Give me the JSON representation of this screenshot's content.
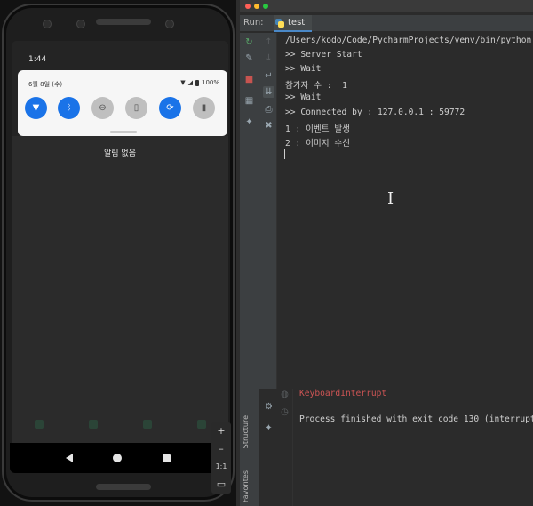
{
  "emulator": {
    "time": "1:44",
    "date": "6월 8일 (수)",
    "battery": "100%",
    "empty_message": "알림 없음",
    "quick_tiles": [
      {
        "name": "wifi-icon",
        "state": "on",
        "glyph": "▼"
      },
      {
        "name": "bluetooth-icon",
        "state": "on",
        "glyph": "ᛒ"
      },
      {
        "name": "do-not-disturb-icon",
        "state": "off",
        "glyph": "⊖"
      },
      {
        "name": "flashlight-icon",
        "state": "off",
        "glyph": "▯"
      },
      {
        "name": "auto-rotate-icon",
        "state": "on",
        "glyph": "⟳"
      },
      {
        "name": "battery-saver-icon",
        "state": "off",
        "glyph": "▮"
      }
    ],
    "zoom": {
      "plus": "+",
      "minus": "–",
      "ratio": "1:1"
    }
  },
  "ide": {
    "run_label": "Run:",
    "tab_label": "test",
    "console_lines": [
      "/Users/kodo/Code/PycharmProjects/venv/bin/python",
      ">> Server Start",
      ">> Wait",
      "참가자 수 :  1",
      ">> Wait",
      ">> Connected by : 127.0.0.1 : 59772",
      "1 : 이벤트 발생",
      "2 : 이미지 수신"
    ],
    "lower_error": "KeyboardInterrupt",
    "lower_process": "Process finished with exit code 130 (interrupt",
    "side_labels": {
      "structure": "Structure",
      "favorites": "Favorites"
    },
    "colors": {
      "error": "#cc5454",
      "accent": "#4a88c7"
    }
  }
}
